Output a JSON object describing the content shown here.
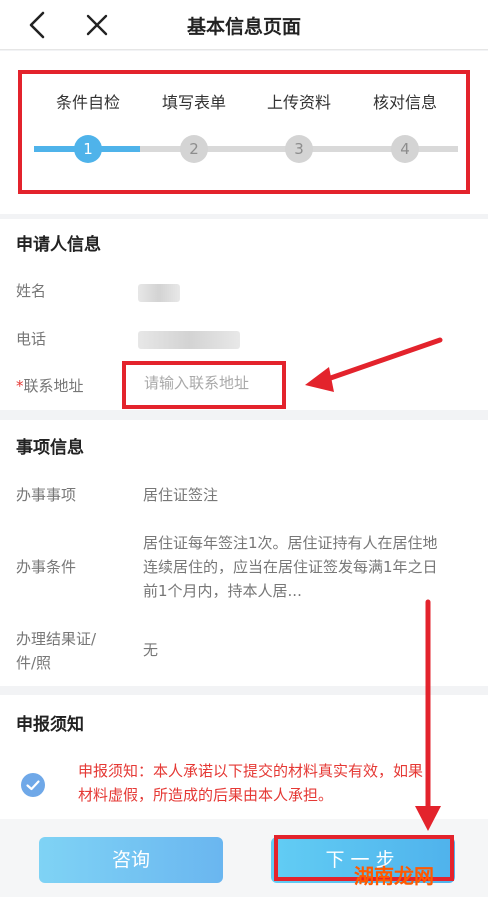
{
  "nav": {
    "title": "基本信息页面",
    "back_icon": "chevron-left-icon",
    "close_icon": "close-icon"
  },
  "steps": [
    {
      "label": "条件自检",
      "number": "1",
      "active": true
    },
    {
      "label": "填写表单",
      "number": "2",
      "active": false
    },
    {
      "label": "上传资料",
      "number": "3",
      "active": false
    },
    {
      "label": "核对信息",
      "number": "4",
      "active": false
    }
  ],
  "applicant": {
    "title": "申请人信息",
    "name_label": "姓名",
    "phone_label": "电话",
    "address_required_mark": "*",
    "address_label": "联系地址",
    "address_placeholder": "请输入联系地址",
    "address_value": ""
  },
  "matter": {
    "title": "事项信息",
    "rows": [
      {
        "label": "办事事项",
        "value": "居住证签注"
      },
      {
        "label": "办事条件",
        "value_lines": [
          "居住证每年签注1次。居住证持有人在居住地",
          "连续居住的，应当在居住证签发每满1年之日",
          "前1个月内，持本人居..."
        ]
      },
      {
        "label_lines": [
          "办理结果证/",
          "件/照"
        ],
        "value": "无"
      }
    ]
  },
  "notice": {
    "title": "申报须知",
    "text_lines": [
      "申报须知：本人承诺以下提交的材料真实有效，如果",
      "材料虚假，所造成的后果由本人承担。"
    ],
    "checked": true
  },
  "buttons": {
    "consult": "咨询",
    "next": "下一步"
  },
  "watermark": "湖南龙网",
  "colors": {
    "accent": "#4fb3ea",
    "annotation_red": "#e3232c",
    "warning_text": "#e53935"
  }
}
